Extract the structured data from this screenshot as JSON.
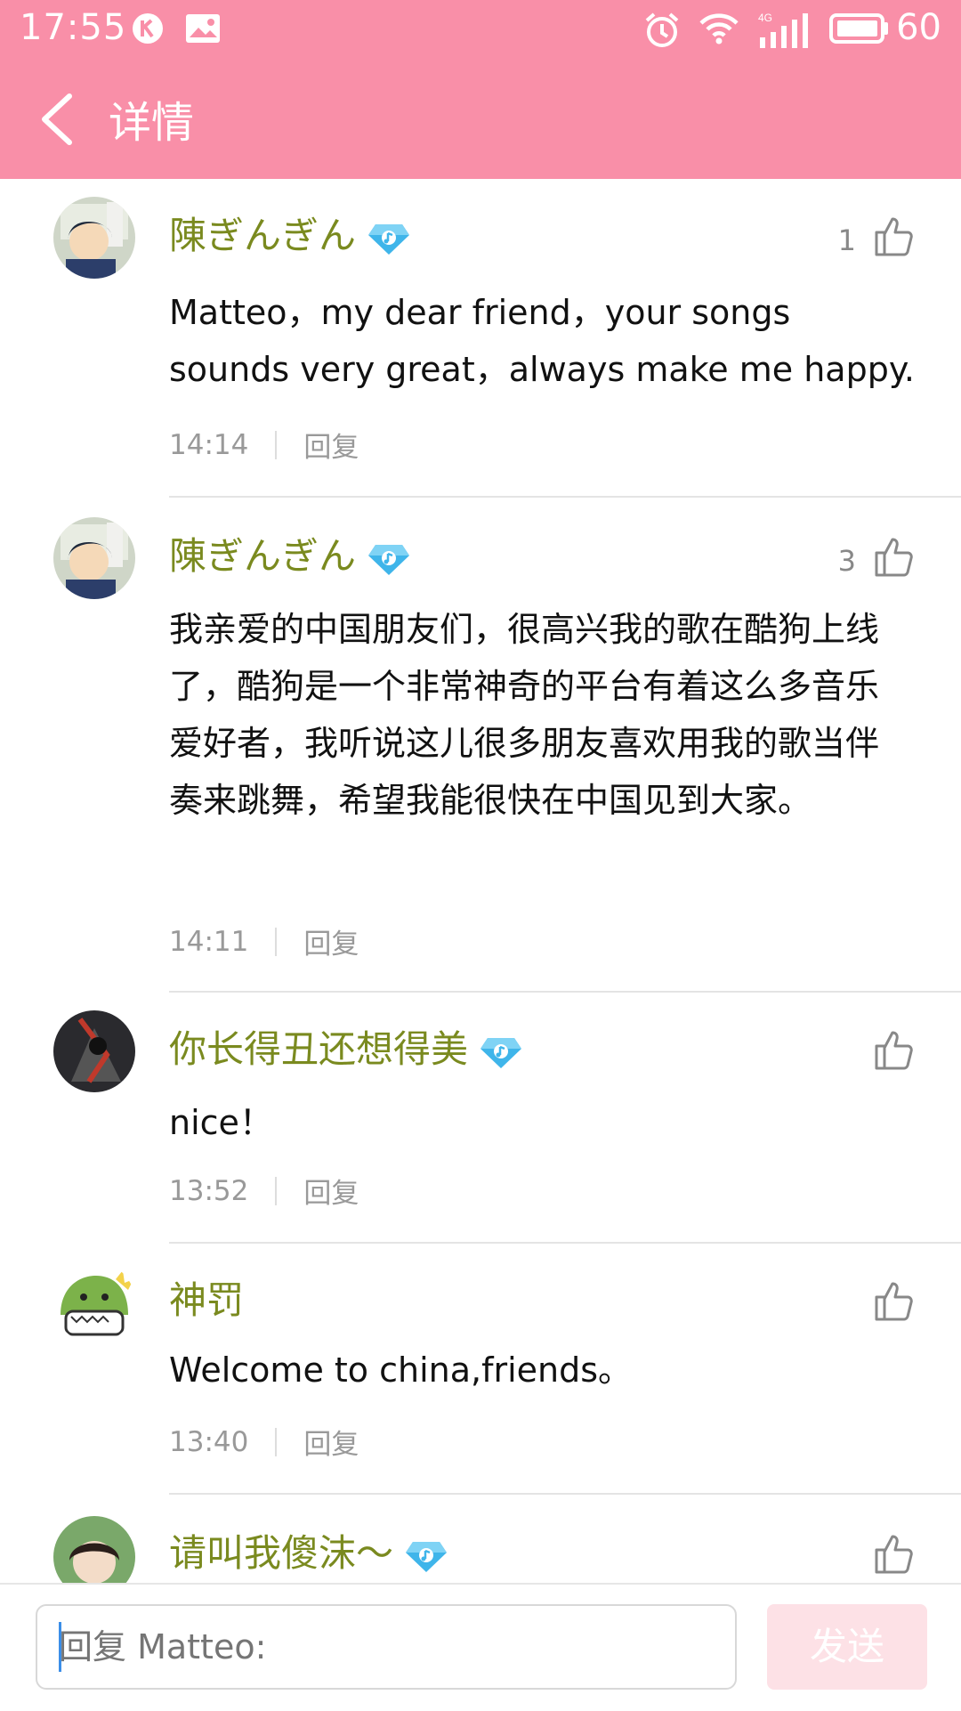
{
  "status_bar": {
    "time": "17:55",
    "battery_level": "60",
    "icons": [
      "k-app-icon",
      "image-icon",
      "alarm-icon",
      "wifi-icon",
      "4g-signal-icon",
      "battery-icon"
    ]
  },
  "header": {
    "title": "详情",
    "background": "#f98fa8"
  },
  "comments": [
    {
      "username": "陳ぎんぎん",
      "vip": true,
      "likes": "1",
      "content": "Matteo，my dear friend，your songs sounds very great，always make me happy.",
      "time": "14:14",
      "reply_label": "回复"
    },
    {
      "username": "陳ぎんぎん",
      "vip": true,
      "likes": "3",
      "content": "我亲爱的中国朋友们，很高兴我的歌在酷狗上线了，酷狗是一个非常神奇的平台有着这么多音乐爱好者，我听说这儿很多朋友喜欢用我的歌当伴奏来跳舞，希望我能很快在中国见到大家。",
      "time": "14:11",
      "reply_label": "回复"
    },
    {
      "username": "你长得丑还想得美",
      "vip": true,
      "likes": "",
      "content": "nice！",
      "time": "13:52",
      "reply_label": "回复"
    },
    {
      "username": "神罚",
      "vip": false,
      "likes": "",
      "content": "Welcome to china,friends。",
      "time": "13:40",
      "reply_label": "回复"
    },
    {
      "username": "请叫我傻沫〜",
      "vip": true,
      "likes": "",
      "content": "",
      "time": "",
      "reply_label": ""
    }
  ],
  "reply_bar": {
    "placeholder": "回复 Matteo:",
    "send_label": "发送"
  },
  "colors": {
    "accent": "#f98fa8",
    "username": "#7a8a1f",
    "send_disabled": "#fde1e6"
  }
}
